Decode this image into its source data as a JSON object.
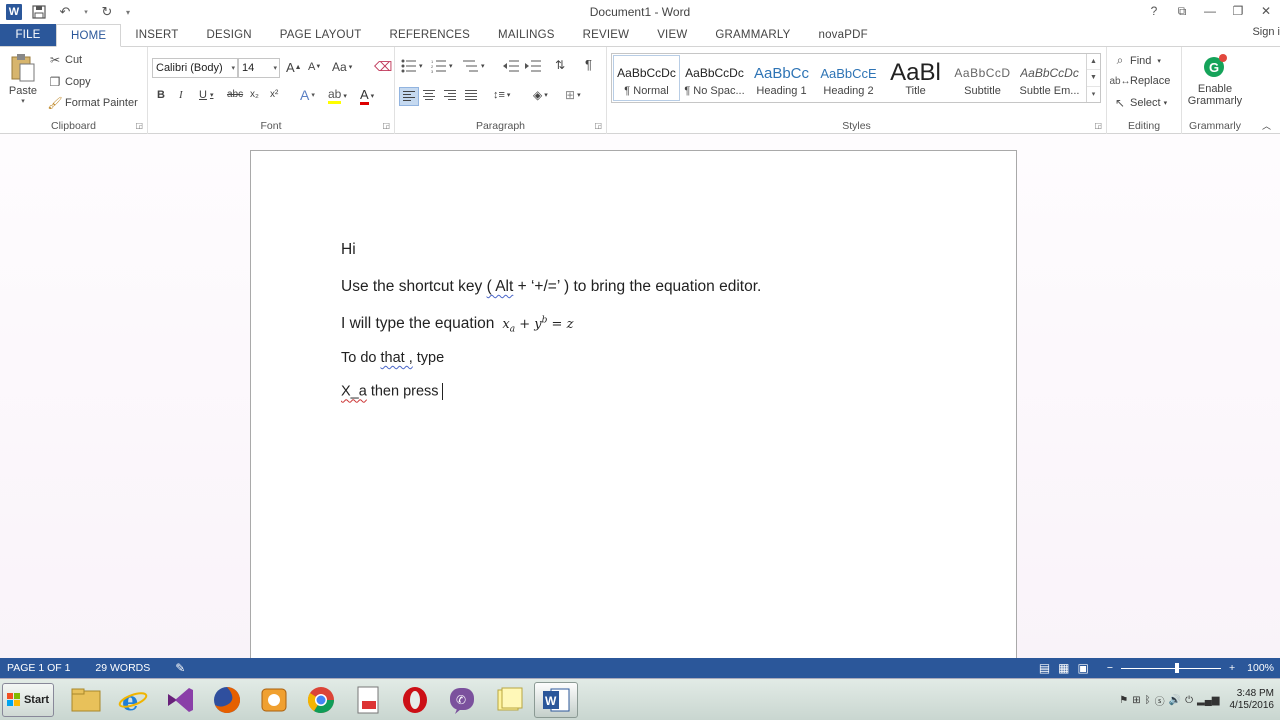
{
  "window": {
    "title": "Document1 - Word",
    "sign_in": "Sign i",
    "help": "?",
    "ribbon_display": "⧉",
    "minimize": "—",
    "restore": "❐",
    "close": "✕"
  },
  "tabs": [
    "FILE",
    "HOME",
    "INSERT",
    "DESIGN",
    "PAGE LAYOUT",
    "REFERENCES",
    "MAILINGS",
    "REVIEW",
    "VIEW",
    "GRAMMARLY",
    "novaPDF"
  ],
  "active_tab": "HOME",
  "clipboard": {
    "paste": "Paste",
    "cut": "Cut",
    "copy": "Copy",
    "format_painter": "Format Painter",
    "label": "Clipboard"
  },
  "font": {
    "name": "Calibri (Body)",
    "size": "14",
    "label": "Font",
    "bold": "B",
    "italic": "I",
    "underline": "U",
    "strike": "abc",
    "subscript": "x₂",
    "superscript": "x²",
    "grow": "A",
    "shrink": "A",
    "case": "Aa",
    "effects": "A",
    "color": "A"
  },
  "paragraph": {
    "label": "Paragraph",
    "pilcrow": "¶"
  },
  "styles": {
    "label": "Styles",
    "items": [
      {
        "preview": "AaBbCcDc",
        "name": "¶ Normal"
      },
      {
        "preview": "AaBbCcDc",
        "name": "¶ No Spac..."
      },
      {
        "preview": "AaBbCc",
        "name": "Heading 1"
      },
      {
        "preview": "AaBbCcE",
        "name": "Heading 2"
      },
      {
        "preview": "AaBl",
        "name": "Title"
      },
      {
        "preview": "AaBbCcD",
        "name": "Subtitle"
      },
      {
        "preview": "AaBbCcDc",
        "name": "Subtle Em..."
      }
    ]
  },
  "editing": {
    "label": "Editing",
    "find": "Find",
    "replace": "Replace",
    "select": "Select"
  },
  "grammarly": {
    "label": "Grammarly",
    "enable": "Enable",
    "grammarly": "Grammarly"
  },
  "document": {
    "line1": "Hi",
    "line2_a": "Use the shortcut key ",
    "line2_b": "( Alt",
    "line2_c": " + ‘+/=’ ) to bring the equation editor.",
    "line3": "I will type the equation",
    "eq": {
      "x": "x",
      "a": "a",
      "plus": " + ",
      "y": "y",
      "b": "b",
      "eq": " = ",
      "z": "z"
    },
    "line4_a": "To do ",
    "line4_b": "that ,",
    "line4_c": " type",
    "line5_a": "X_a",
    "line5_b": " then press"
  },
  "status": {
    "page": "PAGE 1 OF 1",
    "words": "29 WORDS",
    "zoom": "100%",
    "zoom_minus": "−",
    "zoom_plus": "+"
  },
  "taskbar": {
    "start": "Start",
    "clock_time": "3:48 PM",
    "clock_date": "4/15/2016"
  },
  "colors": {
    "accent": "#2b579a",
    "red_squiggle": "#cc3333",
    "blue_squiggle": "#4a66c8"
  }
}
